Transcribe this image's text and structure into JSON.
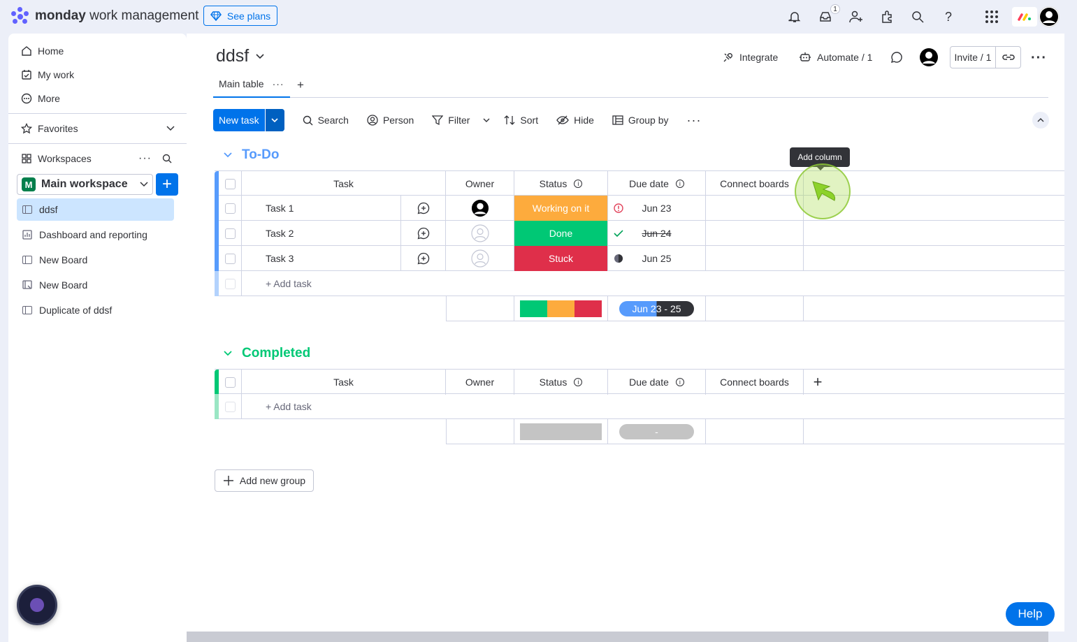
{
  "app": {
    "brand_bold": "monday",
    "brand_rest": " work management",
    "see_plans": "See plans",
    "inbox_badge": "1"
  },
  "sidebar": {
    "nav": [
      "Home",
      "My work",
      "More"
    ],
    "favorites": "Favorites",
    "workspaces": "Workspaces",
    "workspace_name": "Main workspace",
    "workspace_initial": "M",
    "boards": [
      "ddsf",
      "Dashboard and reporting",
      "New Board",
      "New Board",
      "Duplicate of ddsf"
    ]
  },
  "board": {
    "title": "ddsf",
    "integrate": "Integrate",
    "automate": "Automate / 1",
    "invite": "Invite / 1",
    "tab": "Main table",
    "toolbar": {
      "new_task": "New task",
      "search": "Search",
      "person": "Person",
      "filter": "Filter",
      "sort": "Sort",
      "hide": "Hide",
      "group_by": "Group by"
    }
  },
  "columns": {
    "task": "Task",
    "owner": "Owner",
    "status": "Status",
    "due": "Due date",
    "connect": "Connect boards"
  },
  "tooltip": "Add column",
  "groups": [
    {
      "title": "To-Do",
      "color": "#579bfc",
      "rows": [
        {
          "task": "Task 1",
          "status": "Working on it",
          "status_color": "#fdab3d",
          "due": "Jun 23"
        },
        {
          "task": "Task 2",
          "status": "Done",
          "status_color": "#00c875",
          "due": "Jun 24"
        },
        {
          "task": "Task 3",
          "status": "Stuck",
          "status_color": "#df2f4a",
          "due": "Jun 25"
        }
      ],
      "add_task": "+ Add task",
      "summary_date": "Jun 23 - 25"
    },
    {
      "title": "Completed",
      "color": "#00c875",
      "rows": [],
      "add_task": "+ Add task",
      "summary_date": "-"
    }
  ],
  "add_group": "Add new group",
  "help": "Help"
}
